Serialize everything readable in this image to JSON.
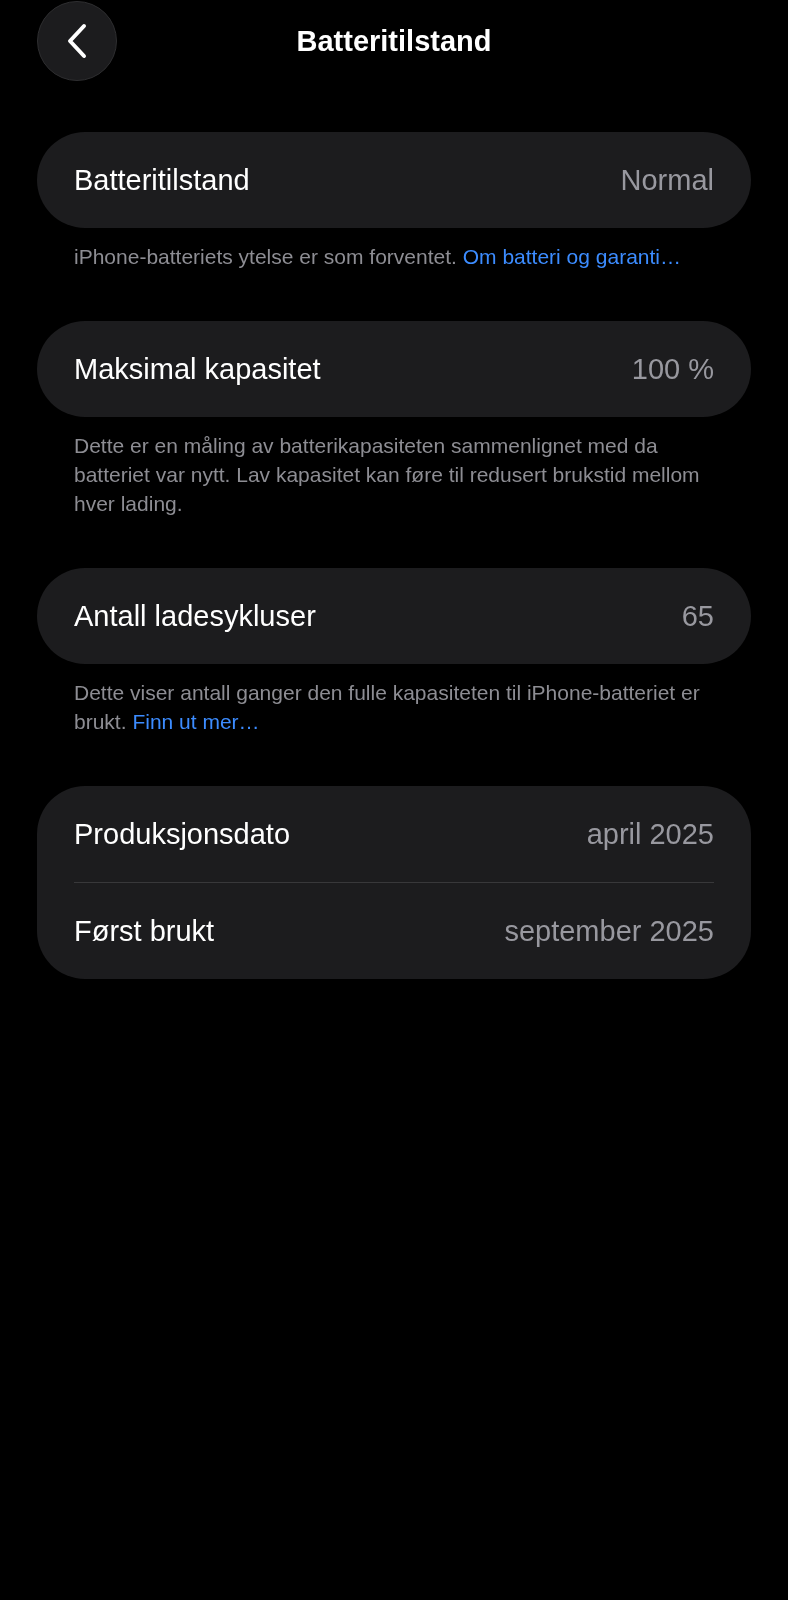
{
  "nav_bar": {
    "title": "Batteritilstand"
  },
  "sections": [
    {
      "rows": [
        {
          "label": "Batteritilstand",
          "value": "Normal"
        }
      ],
      "footer": {
        "text": "iPhone-batteriets ytelse er som forventet.",
        "link": "Om batteri og garanti…"
      }
    },
    {
      "rows": [
        {
          "label": "Maksimal kapasitet",
          "value": "100 %"
        }
      ],
      "footer": {
        "text": "Dette er en måling av batterikapasiteten sammenlignet med da batteriet var nytt. Lav kapasitet kan føre til redusert brukstid mellom hver lading."
      }
    },
    {
      "rows": [
        {
          "label": "Antall ladesykluser",
          "value": "65"
        }
      ],
      "footer": {
        "text": "Dette viser antall ganger den fulle kapasiteten til iPhone-batteriet er brukt.",
        "link": "Finn ut mer…"
      }
    },
    {
      "rows": [
        {
          "label": "Produksjonsdato",
          "value": "april 2025"
        },
        {
          "label": "Først brukt",
          "value": "september 2025"
        }
      ]
    }
  ]
}
